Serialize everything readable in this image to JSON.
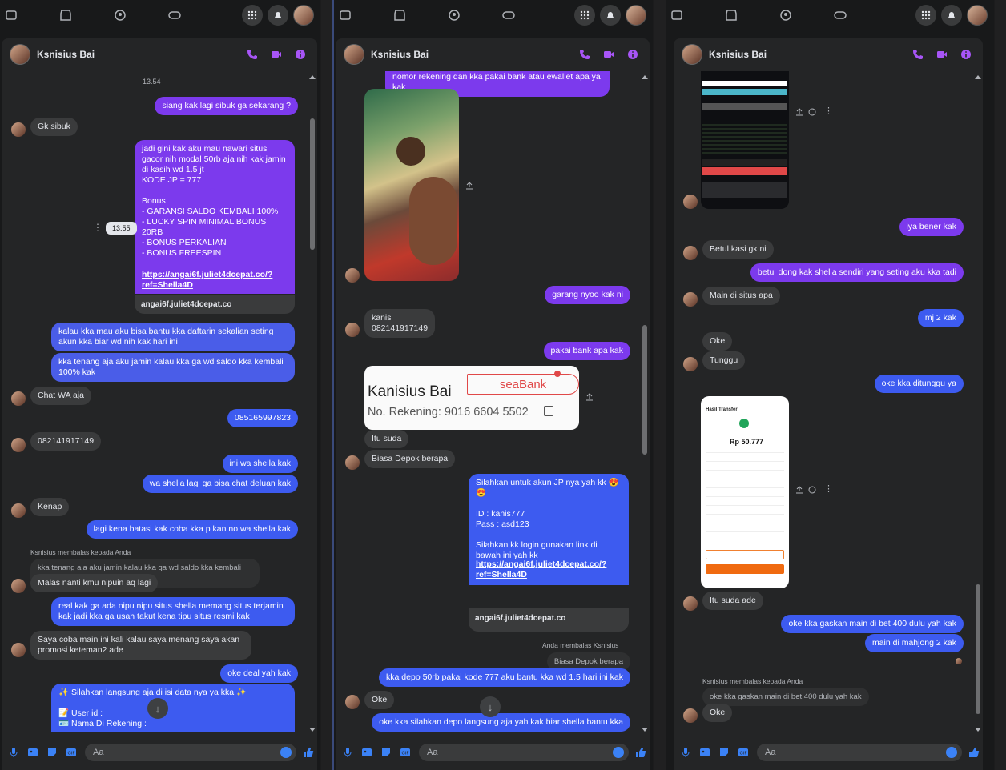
{
  "colors": {
    "accent": "#a855f7",
    "messenger_blue": "#3b82f6",
    "bubble_out": "#7c3aed",
    "bubble_in": "#3a3b3c"
  },
  "contact_name": "Ksnisius Bai",
  "composer_placeholder": "Aa",
  "panel1": {
    "time1": "13.54",
    "time2": "13.55",
    "msgs": [
      "siang kak lagi sibuk ga sekarang ?",
      "Gk sibuk",
      "jadi gini kak aku mau nawari situs gacor nih modal 50rb aja nih kak jamin di kasih wd 1.5 jt\nKODE JP = 777\n\nBonus\n- GARANSI SALDO KEMBALI 100%\n- LUCKY SPIN MINIMAL BONUS 20RB\n- BONUS PERKALIAN\n- BONUS FREESPIN\n\nLink Daftar :",
      "https://angai6f.juliet4dcepat.co/?ref=Shella4D",
      "angai6f.juliet4dcepat.co",
      "kalau kka mau aku bisa bantu kka daftarin sekalian seting akun kka biar wd nih kak hari ini",
      "kka tenang aja aku jamin kalau kka ga wd saldo kka kembali 100% kak",
      "Chat WA aja",
      "085165997823",
      "082141917149",
      "ini wa shella kak",
      "wa shella lagi ga bisa chat deluan kak",
      "Kenap",
      "lagi kena batasi kak coba kka p kan no wa shella kak",
      "Ksnisius membalas kepada Anda",
      "kka tenang aja aku jamin kalau kka ga wd saldo kka kembali 100% kak",
      "Malas nanti kmu nipuin aq lagi",
      "real kak ga ada nipu nipu situs shella memang situs terjamin kak jadi kka ga usah takut kena tipu situs resmi kak",
      "Saya coba main ini kali kalau saya menang saya akan promosi keteman2 ade",
      "oke deal yah kak",
      "✨ Silahkan langsung aja di isi data nya ya kka ✨\n\n📝 User id :\n🪪 Nama Di Rekening :"
    ]
  },
  "panel2": {
    "msgs": [
      "nomor rekening dan kka pakai bank atau ewallet apa ya kak",
      "garang nyoo kak ni",
      "kanis\n082141917149",
      "pakai bank apa kak",
      "Itu suda",
      "Biasa Depok berapa",
      "Silahkan untuk akun JP nya yah kk 😍😍\n\nID : kanis777\nPass : asd123\n\nSilahkan kk login gunakan link di bawah ini yah kk\n\nLink : ",
      "https://angai6f.juliet4dcepat.co/?ref=Shella4D",
      "angai6f.juliet4dcepat.co",
      "Anda membalas Ksnisius",
      "Biasa Depok berapa",
      "kka depo 50rb pakai kode 777 aku bantu kka wd 1.5 hari ini kak",
      "Oke",
      "oke kka silahkan depo langsung aja yah kak biar shella bantu kka"
    ],
    "bank_card": {
      "name": "Kanisius Bai",
      "bank": "seaBank",
      "account": "No. Rekening: 9016 6604 5502"
    }
  },
  "panel3": {
    "msgs": [
      "iya bener kak",
      "Betul kasi gk ni",
      "betul dong kak shella sendiri yang seting aku kka tadi",
      "Main di situs apa",
      "mj 2 kak",
      "Oke",
      "Tunggu",
      "oke kka ditunggu ya",
      "Itu suda ade",
      "oke kka gaskan main di bet 400 dulu yah kak",
      "main di mahjong 2 kak",
      "Ksnisius membalas kepada Anda",
      "oke kka gaskan main di bet 400 dulu yah kak",
      "Oke"
    ],
    "receipt": {
      "title": "Hasil Transfer",
      "amount": "Rp 50.777"
    }
  }
}
